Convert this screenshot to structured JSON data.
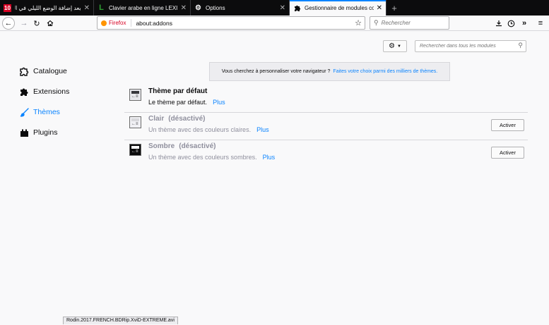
{
  "tabs": [
    {
      "title": "بعد إضافة الوضع الليلي في التويتر وا",
      "favicon_text": "10",
      "favicon_color": "#d70022"
    },
    {
      "title": "Clavier arabe en ligne LEXILOGOS",
      "favicon_text": "L",
      "favicon_color": "#2e9e32"
    },
    {
      "title": "Options",
      "favicon_icon": "gear-icon"
    },
    {
      "title": "Gestionnaire de modules complémentaires",
      "favicon_icon": "puzzle-icon",
      "active": true
    }
  ],
  "navbar": {
    "identity_label": "Firefox",
    "url": "about:addons",
    "search_placeholder": "Rechercher"
  },
  "addons": {
    "search_placeholder": "Rechercher dans tous les modules",
    "categories": [
      {
        "label": "Catalogue",
        "icon": "catalog-icon"
      },
      {
        "label": "Extensions",
        "icon": "puzzle-icon"
      },
      {
        "label": "Thèmes",
        "icon": "brush-icon",
        "selected": true
      },
      {
        "label": "Plugins",
        "icon": "plugin-icon"
      }
    ],
    "banner": {
      "text": "Vous cherchez à personnaliser votre navigateur ?",
      "link": "Faites votre choix parmi des milliers de thèmes."
    },
    "themes": [
      {
        "name": "Thème par défaut",
        "status": "",
        "description": "Le thème par défaut.",
        "more": "Plus",
        "button": ""
      },
      {
        "name": "Clair",
        "status": "(désactivé)",
        "description": "Un thème avec des couleurs claires.",
        "more": "Plus",
        "button": "Activer"
      },
      {
        "name": "Sombre",
        "status": "(désactivé)",
        "description": "Un thème avec des couleurs sombres.",
        "more": "Plus",
        "button": "Activer"
      }
    ]
  },
  "status_link": "Rodin.2017.FRENCH.BDRip.XviD-EXTREME.avi",
  "colors": {
    "accent": "#0a84ff",
    "tab_strip": "#0c0c0d",
    "page_bg": "#f9f9fa"
  }
}
